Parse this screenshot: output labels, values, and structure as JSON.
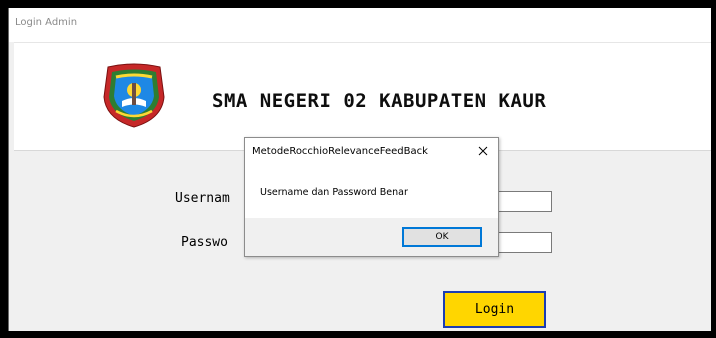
{
  "window": {
    "title": "Login Admin"
  },
  "header": {
    "school_name": "SMA NEGERI 02 KABUPATEN KAUR",
    "logo_icon": "school-crest-icon"
  },
  "form": {
    "username_label": "Usernam",
    "password_label": "Passwo",
    "username_value": "",
    "password_value": "",
    "login_label": "Login",
    "login_color": "#ffd600"
  },
  "dialog": {
    "title": "MetodeRocchioRelevanceFeedBack",
    "close_label": "✕",
    "message": "Username dan Password Benar",
    "ok_label": "OK"
  }
}
